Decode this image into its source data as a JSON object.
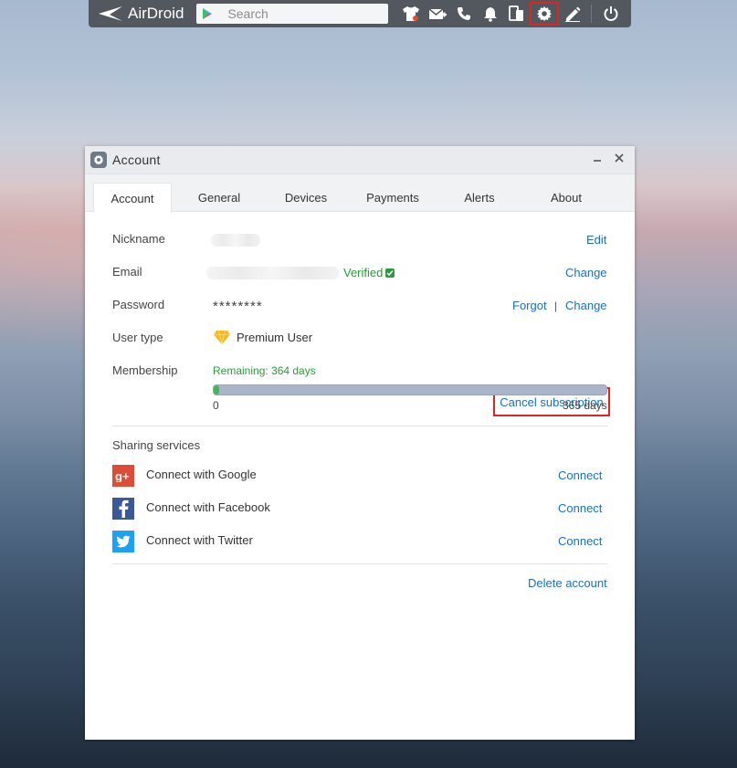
{
  "topbar": {
    "logo_text": "AirDroid",
    "search_placeholder": "Search",
    "icons": [
      "tshirt-icon",
      "add-mail-icon",
      "phone-icon",
      "bell-icon",
      "devices-icon",
      "gear-icon",
      "edit-icon",
      "power-icon"
    ]
  },
  "window": {
    "title": "Account",
    "tabs": [
      "Account",
      "General",
      "Devices",
      "Payments",
      "Alerts",
      "About"
    ],
    "active_tab": "Account"
  },
  "account": {
    "nickname_label": "Nickname",
    "nickname_action": "Edit",
    "email_label": "Email",
    "email_status": "Verified",
    "email_action": "Change",
    "password_label": "Password",
    "password_value": "********",
    "password_forgot": "Forgot",
    "password_separator": "|",
    "password_change": "Change",
    "usertype_label": "User type",
    "usertype_value": "Premium User",
    "usertype_action": "Cancel subscription",
    "membership_label": "Membership",
    "membership_remaining": "Remaining: 364 days",
    "membership_fraction_used": 0.0027,
    "membership_start": "0",
    "membership_end": "365 days"
  },
  "sharing": {
    "title": "Sharing services",
    "items": [
      {
        "label": "Connect with Google",
        "action": "Connect"
      },
      {
        "label": "Connect with Facebook",
        "action": "Connect"
      },
      {
        "label": "Connect with Twitter",
        "action": "Connect"
      }
    ]
  },
  "footer": {
    "delete_account": "Delete account"
  },
  "colors": {
    "accent_link": "#1a6fc6",
    "verified_green": "#2a9b3a",
    "highlight_red": "#e02424",
    "google_red": "#dd4b39",
    "facebook_blue": "#3b5998",
    "twitter_blue": "#1da1f2"
  }
}
